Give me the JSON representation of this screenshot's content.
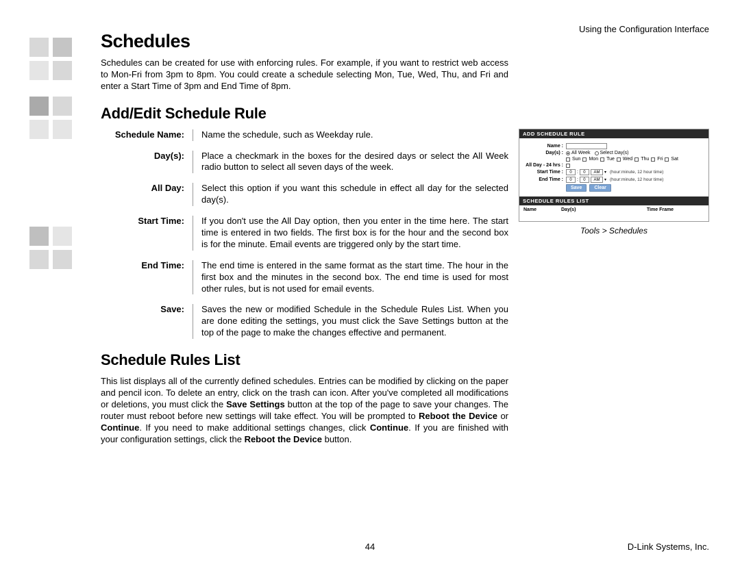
{
  "header_right": "Using the Configuration Interface",
  "h1": "Schedules",
  "intro": "Schedules can be created for use with enforcing rules. For example, if you want to restrict web access to Mon-Fri from 3pm to 8pm. You could create a schedule selecting Mon, Tue, Wed, Thu, and Fri and enter a Start Time of 3pm and End Time of 8pm.",
  "h2a": "Add/Edit Schedule Rule",
  "defs": [
    {
      "label": "Schedule Name:",
      "desc": "Name the schedule, such as Weekday rule."
    },
    {
      "label": "Day(s):",
      "desc": "Place a checkmark in the boxes for the desired days or select the All Week radio button to select all seven days of the week."
    },
    {
      "label": "All Day:",
      "desc": "Select this option if you want this schedule in effect all day for the selected day(s)."
    },
    {
      "label": "Start Time:",
      "desc": "If you don't use the All Day option, then you enter in the time here. The start time is entered in two fields. The first box is for the hour and the second box is for the minute. Email events are triggered only by the start time."
    },
    {
      "label": "End Time:",
      "desc": "The end time is entered in the same format as the start time. The hour in the first box and the minutes in the second box. The end time is used for most other rules, but is not used for email events."
    },
    {
      "label": "Save:",
      "desc": "Saves the new or modified Schedule in the Schedule Rules List. When you are done editing the settings, you must click the Save Settings button at the top of the page to make the changes effective and permanent."
    }
  ],
  "h2b": "Schedule Rules List",
  "rules_para_pre": "This list displays all of the currently defined schedules. Entries can be modified by clicking on the paper and pencil icon. To delete an entry, click on the trash can icon. After you've completed all modifications or deletions, you must click the ",
  "save_settings": "Save Settings",
  "rules_mid1": " button at the top of the page to save your changes. The router must reboot before new settings will take effect. You will be prompted to ",
  "reboot_device": "Reboot the Device",
  "rules_mid2": " or ",
  "continue": "Continue",
  "rules_mid3": ". If you need to make additional settings changes, click ",
  "rules_mid4": ". If you are finished with your configuration settings, click the ",
  "rules_end": " button.",
  "panel": {
    "add_header": "ADD SCHEDULE RULE",
    "name_label": "Name :",
    "days_label": "Day(s) :",
    "all_week": "All Week",
    "select_days": "Select Day(s)",
    "days": [
      "Sun",
      "Mon",
      "Tue",
      "Wed",
      "Thu",
      "Fri",
      "Sat"
    ],
    "allday_label": "All Day - 24 hrs :",
    "start_label": "Start Time :",
    "end_label": "End Time :",
    "zero": "0",
    "am": "AM",
    "hint": "(hour:minute, 12 hour time)",
    "save_btn": "Save",
    "clear_btn": "Clear",
    "list_header": "SCHEDULE RULES LIST",
    "col_name": "Name",
    "col_days": "Day(s)",
    "col_time": "Time Frame"
  },
  "caption": "Tools > Schedules",
  "page_num": "44",
  "footer_right": "D-Link Systems, Inc."
}
